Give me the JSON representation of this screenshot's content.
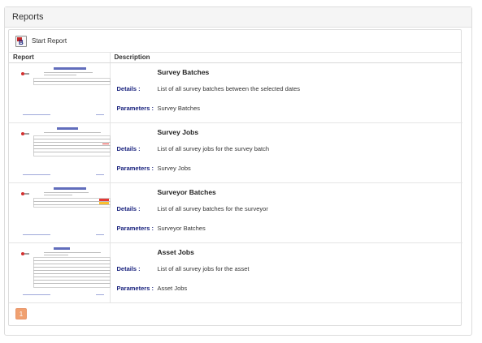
{
  "header": {
    "title": "Reports"
  },
  "toolbar": {
    "start_report_label": "Start Report",
    "start_report_icon": "report-icon"
  },
  "table": {
    "columns": [
      "Report",
      "Description"
    ],
    "details_key": "Details :",
    "parameters_key": "Parameters :",
    "rows": [
      {
        "title": "Survey Batches",
        "details": "List of all survey batches between the selected dates",
        "parameters": "Survey Batches"
      },
      {
        "title": "Survey Jobs",
        "details": "List of all survey jobs for the survey batch",
        "parameters": "Survey Jobs"
      },
      {
        "title": "Surveyor Batches",
        "details": "List of all survey batches for the surveyor",
        "parameters": "Surveyor Batches"
      },
      {
        "title": "Asset Jobs",
        "details": "List of all survey jobs for the asset",
        "parameters": "Asset Jobs"
      }
    ]
  },
  "pagination": {
    "current_page": "1"
  },
  "colors": {
    "accent": "#f0a070",
    "label_blue": "#1a237e"
  }
}
